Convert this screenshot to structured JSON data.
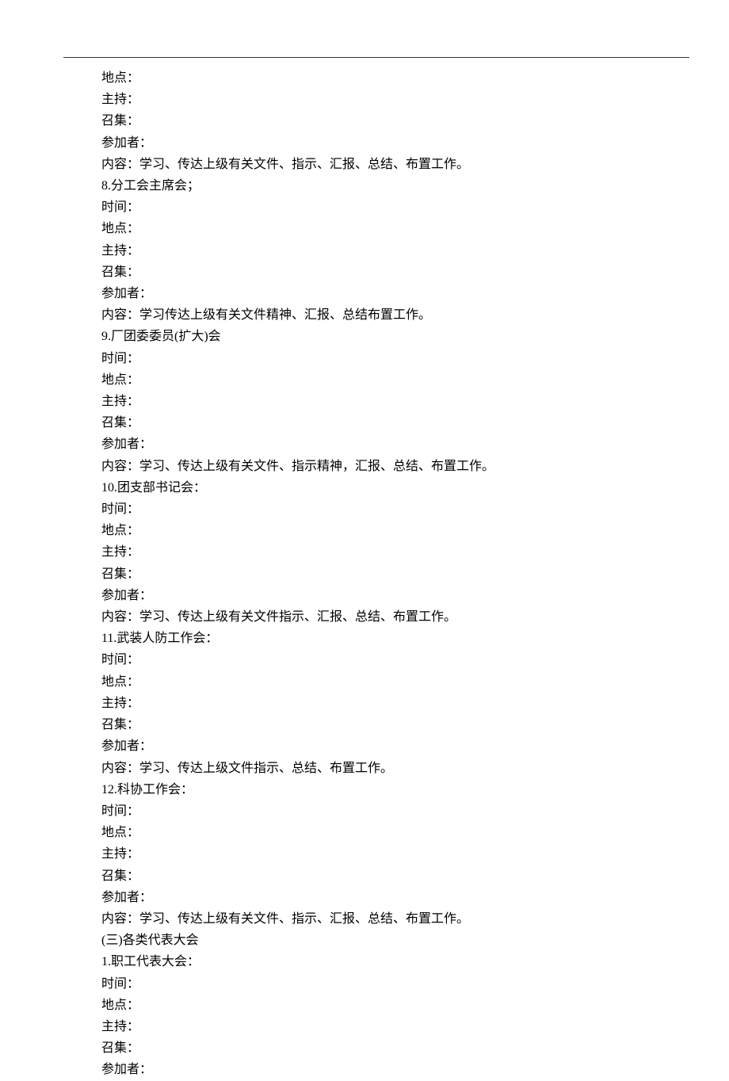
{
  "lines": [
    "地点：",
    "主持：",
    "召集：",
    "参加者：",
    "内容：学习、传达上级有关文件、指示、汇报、总结、布置工作。",
    "8.分工会主席会；",
    "时间：",
    "地点：",
    "主持：",
    "召集：",
    "参加者：",
    "内容：学习传达上级有关文件精神、汇报、总结布置工作。",
    "9.厂团委委员(扩大)会",
    "时间：",
    "地点：",
    "主持：",
    "召集：",
    "参加者：",
    "内容：学习、传达上级有关文件、指示精神，汇报、总结、布置工作。",
    "10.团支部书记会：",
    "时间：",
    "地点：",
    "主持：",
    "召集：",
    "参加者：",
    "内容：学习、传达上级有关文件指示、汇报、总结、布置工作。",
    "11.武装人防工作会：",
    "时间：",
    "地点：",
    "主持：",
    "召集：",
    "参加者：",
    "内容：学习、传达上级文件指示、总结、布置工作。",
    "12.科协工作会：",
    "时间：",
    "地点：",
    "主持：",
    "召集：",
    "参加者：",
    "内容：学习、传达上级有关文件、指示、汇报、总结、布置工作。",
    "(三)各类代表大会",
    "1.职工代表大会：",
    "时间：",
    "地点：",
    "主持：",
    "召集：",
    "参加者："
  ]
}
